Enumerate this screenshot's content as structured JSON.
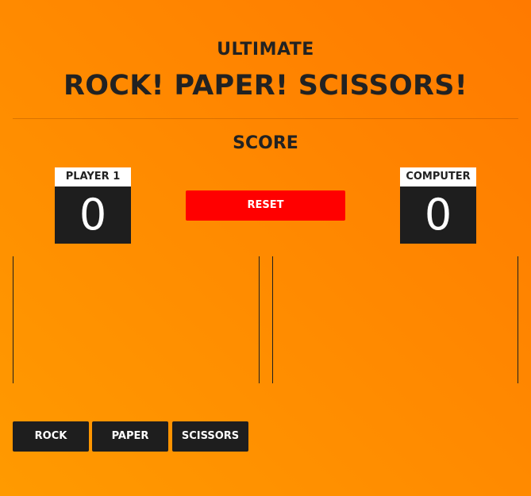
{
  "header": {
    "subtitle": "ULTIMATE",
    "title": "ROCK! PAPER! SCISSORS!"
  },
  "scoreboard": {
    "heading": "SCORE",
    "player": {
      "label": "PLAYER 1",
      "score": "0"
    },
    "computer": {
      "label": "COMPUTER",
      "score": "0"
    },
    "reset_label": "RESET"
  },
  "choices": [
    {
      "label": "ROCK"
    },
    {
      "label": "PAPER"
    },
    {
      "label": "SCISSORS"
    }
  ],
  "colors": {
    "background_start": "#ff9a00",
    "background_end": "#ff7a00",
    "dark": "#1e1e1e",
    "reset": "#ff0000",
    "text": "#222222"
  }
}
